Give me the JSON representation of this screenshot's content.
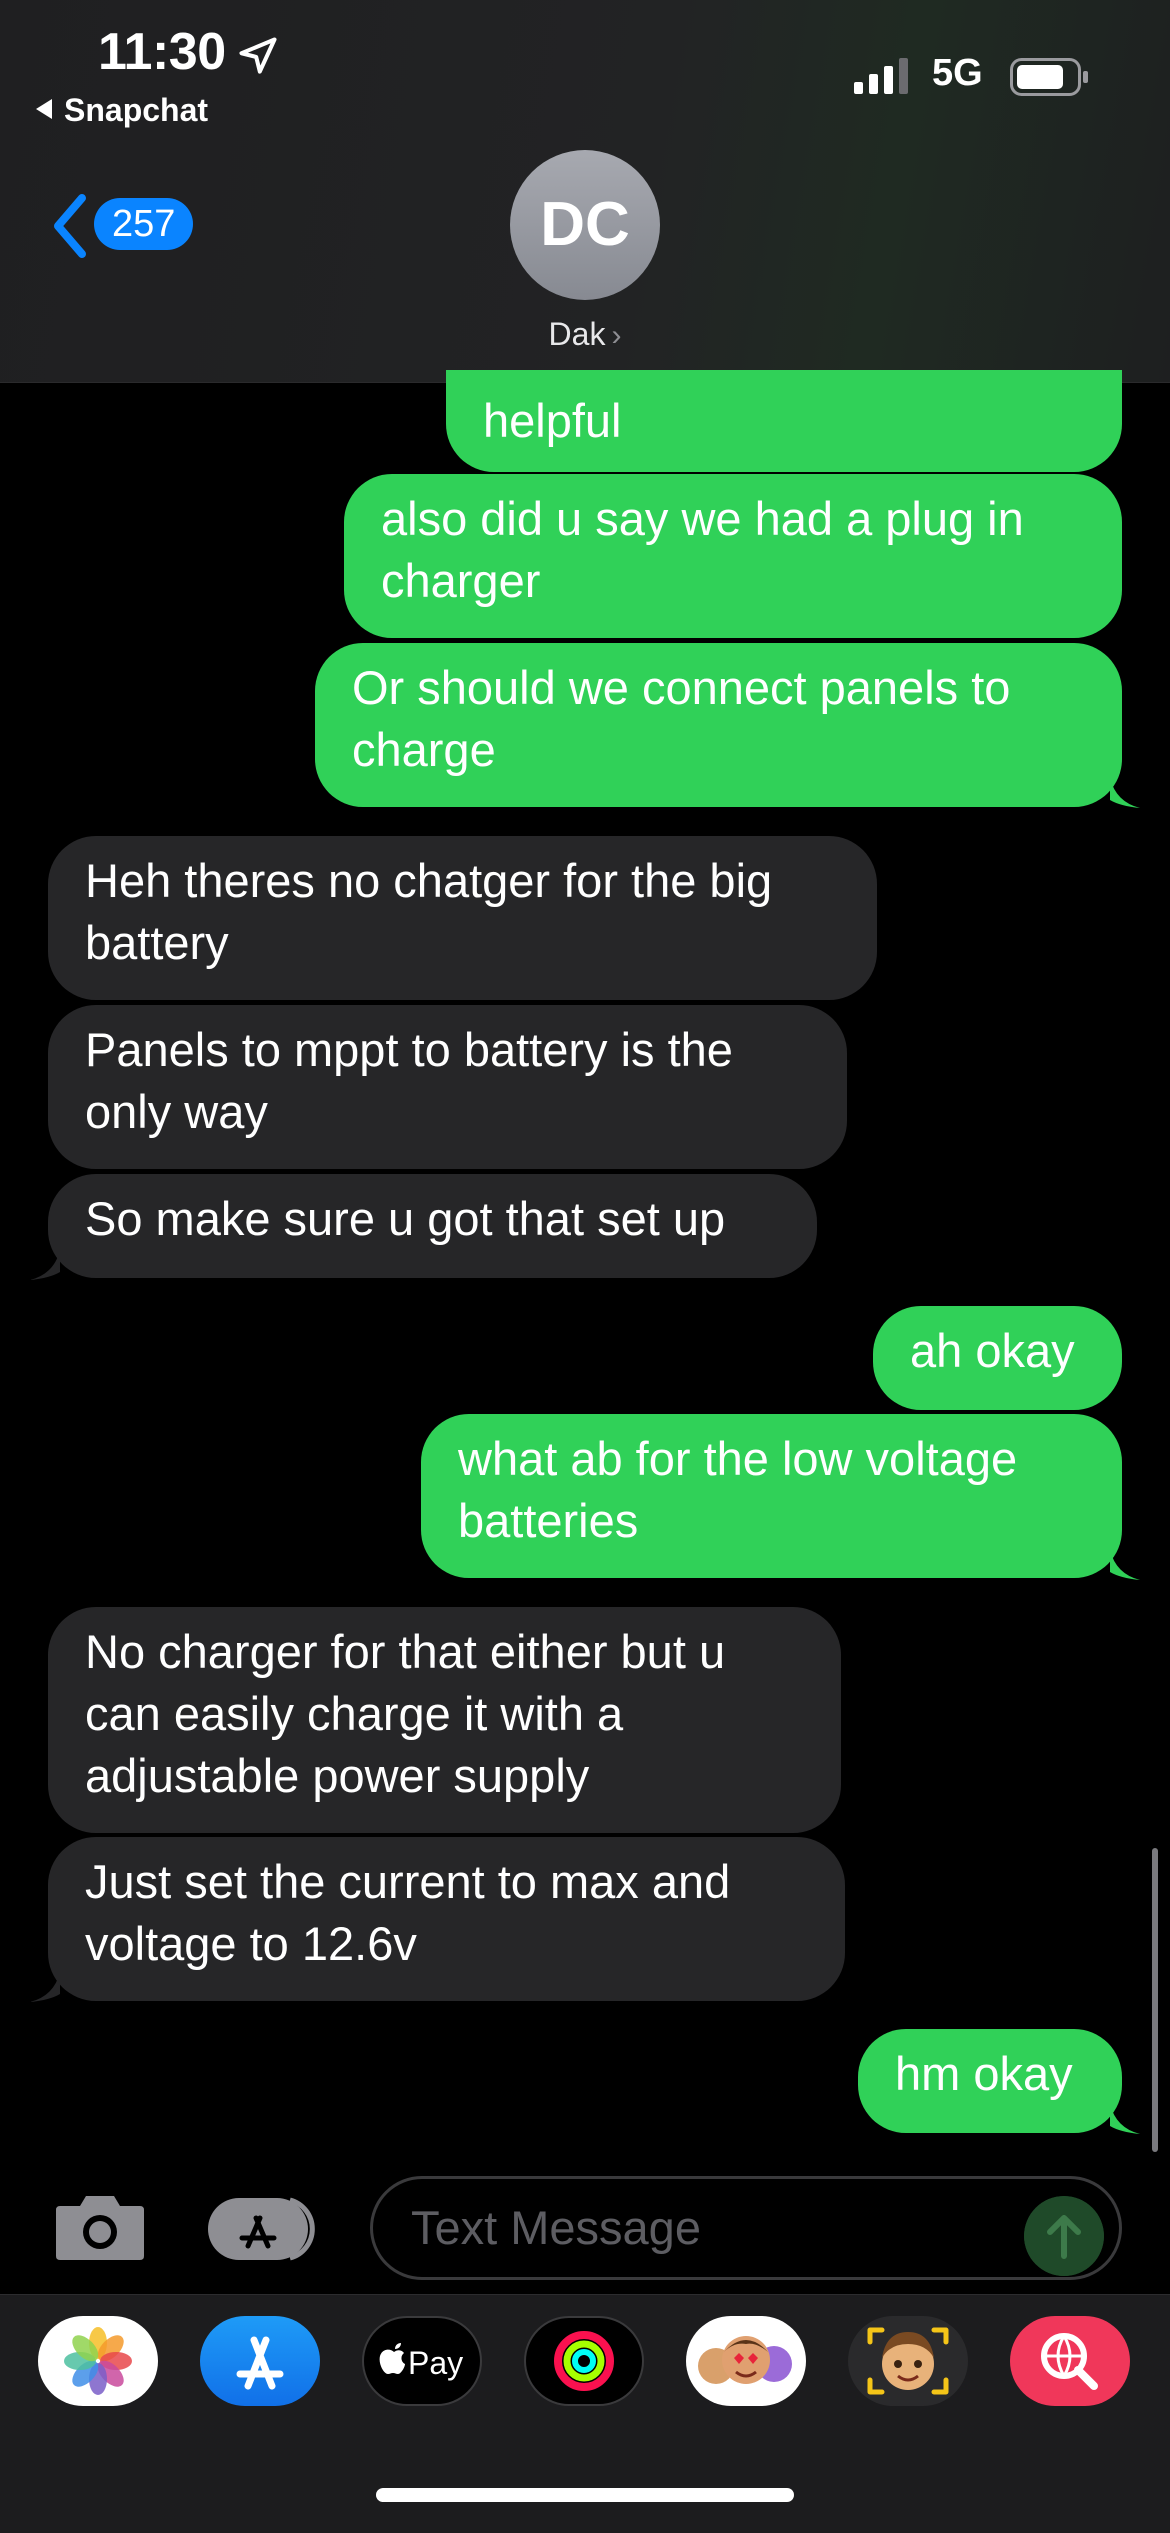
{
  "status_bar": {
    "time": "11:30",
    "back_app": "Snapchat",
    "network": "5G"
  },
  "nav": {
    "unread_count": "257",
    "contact_initials": "DC",
    "contact_name": "Dak"
  },
  "messages": [
    {
      "from": "me",
      "text": "helpful"
    },
    {
      "from": "me",
      "text": "also did u say we had a plug in charger"
    },
    {
      "from": "me",
      "text": "Or should we connect panels to charge"
    },
    {
      "from": "them",
      "text": "Heh theres no chatger for the big battery"
    },
    {
      "from": "them",
      "text": "Panels to mppt to battery is the only way"
    },
    {
      "from": "them",
      "text": "So make sure u got that set up"
    },
    {
      "from": "me",
      "text": "ah okay"
    },
    {
      "from": "me",
      "text": "what ab for the low voltage batteries"
    },
    {
      "from": "them",
      "text": "No charger for that either but u can easily charge it with a adjustable power supply"
    },
    {
      "from": "them",
      "text": "Just set the current to max and voltage to 12.6v"
    },
    {
      "from": "me",
      "text": "hm okay"
    }
  ],
  "composer": {
    "placeholder": "Text Message"
  },
  "app_drawer": {
    "apps": [
      "photos-icon",
      "app-store-icon",
      "apple-pay-icon",
      "fitness-icon",
      "memoji-stickers-icon",
      "memoji-icon",
      "web-search-icon"
    ],
    "apple_pay_label": "Pay"
  },
  "colors": {
    "sent_bubble": "#30d158",
    "received_bubble": "#262628",
    "accent": "#0a84ff"
  }
}
